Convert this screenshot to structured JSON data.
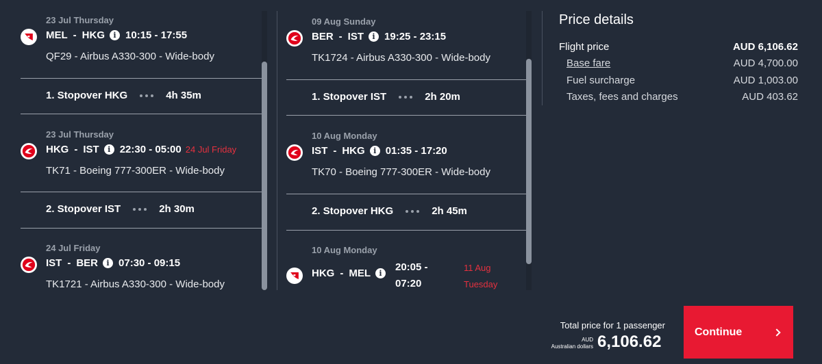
{
  "outbound": {
    "segments": [
      {
        "date": "23 Jul Thursday",
        "from": "MEL",
        "to": "HKG",
        "times": "10:15 - 17:55",
        "next_day": "",
        "aircraft": "QF29 - Airbus A330-300 - Wide-body",
        "airline": "qantas"
      },
      {
        "date": "23 Jul Thursday",
        "from": "HKG",
        "to": "IST",
        "times": "22:30 - 05:00",
        "next_day": "24 Jul Friday",
        "aircraft": "TK71 - Boeing 777-300ER - Wide-body",
        "airline": "turkish"
      },
      {
        "date": "24 Jul Friday",
        "from": "IST",
        "to": "BER",
        "times": "07:30 - 09:15",
        "next_day": "",
        "aircraft": "TK1721 - Airbus A330-300 - Wide-body",
        "airline": "turkish"
      }
    ],
    "stopovers": [
      {
        "label": "1. Stopover HKG",
        "duration": "4h 35m"
      },
      {
        "label": "2. Stopover IST",
        "duration": "2h 30m"
      }
    ]
  },
  "inbound": {
    "segments": [
      {
        "date": "09 Aug Sunday",
        "from": "BER",
        "to": "IST",
        "times": "19:25 - 23:15",
        "next_day": "",
        "aircraft": "TK1724 - Airbus A330-300 - Wide-body",
        "airline": "turkish"
      },
      {
        "date": "10 Aug Monday",
        "from": "IST",
        "to": "HKG",
        "times": "01:35 - 17:20",
        "next_day": "",
        "aircraft": "TK70 - Boeing 777-300ER - Wide-body",
        "airline": "turkish"
      },
      {
        "date": "10 Aug Monday",
        "from": "HKG",
        "to": "MEL",
        "time_dep": "20:05 -",
        "time_arr": "07:20",
        "next_day_line1": "11 Aug",
        "next_day_line2": "Tuesday",
        "airline": "qantas"
      }
    ],
    "stopovers": [
      {
        "label": "1. Stopover IST",
        "duration": "2h 20m"
      },
      {
        "label": "2. Stopover HKG",
        "duration": "2h 45m"
      }
    ]
  },
  "price": {
    "title": "Price details",
    "flight_price_label": "Flight price",
    "flight_price_value": "AUD 6,106.62",
    "base_fare_label": "Base fare",
    "base_fare_value": "AUD 4,700.00",
    "fuel_label": "Fuel surcharge",
    "fuel_value": "AUD 1,003.00",
    "taxes_label": "Taxes, fees and charges",
    "taxes_value": "AUD 403.62"
  },
  "footer": {
    "total_label": "Total price for 1 passenger",
    "currency_code": "AUD",
    "currency_name": "Australian dollars",
    "total_amount": "6,106.62",
    "continue_label": "Continue"
  },
  "icons": {
    "info": "info-icon",
    "next": "chevron-right-icon",
    "dots": "stopover-dots-icon"
  },
  "colors": {
    "background": "#232b38",
    "accent": "#e81932",
    "next_day": "#e5313f"
  }
}
